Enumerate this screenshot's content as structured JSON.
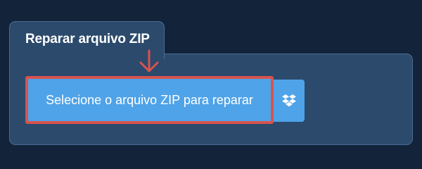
{
  "tab": {
    "title": "Reparar arquivo ZIP"
  },
  "actions": {
    "select_label": "Selecione o arquivo ZIP para reparar",
    "dropbox_icon": "dropbox-icon"
  },
  "colors": {
    "page_background": "#12233a",
    "panel_background": "#2b4a6c",
    "button_blue": "#4fa3e8",
    "highlight_red": "#d9534f"
  }
}
